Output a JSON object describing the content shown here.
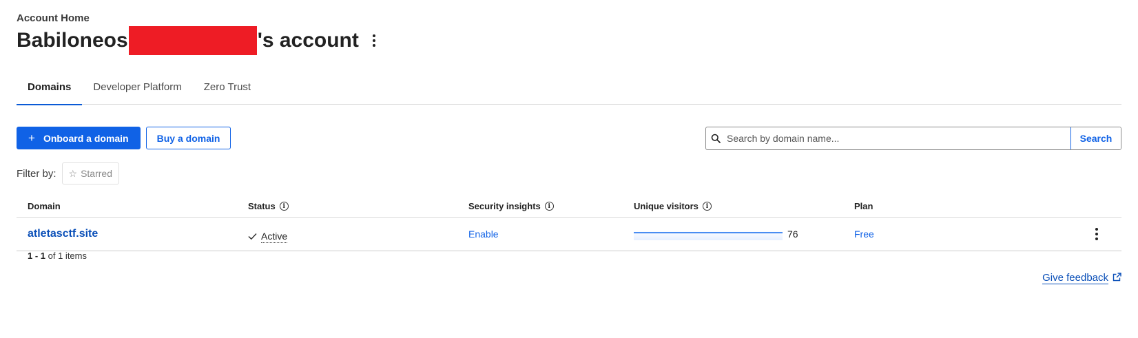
{
  "header": {
    "breadcrumb": "Account Home",
    "account_name_prefix": "Babiloneos",
    "account_name_suffix": "'s account",
    "redaction_color": "#ee1c25"
  },
  "tabs": [
    {
      "label": "Domains",
      "active": true
    },
    {
      "label": "Developer Platform",
      "active": false
    },
    {
      "label": "Zero Trust",
      "active": false
    }
  ],
  "actions": {
    "onboard_label": "Onboard a domain",
    "buy_label": "Buy a domain"
  },
  "search": {
    "placeholder": "Search by domain name...",
    "value": "",
    "button_label": "Search",
    "icon": "search-icon"
  },
  "filter": {
    "label": "Filter by:",
    "starred_label": "Starred",
    "icon": "star-outline-icon"
  },
  "table": {
    "columns": [
      "Domain",
      "Status",
      "Security insights",
      "Unique visitors",
      "Plan"
    ],
    "rows": [
      {
        "domain": "atletasctf.site",
        "status": "Active",
        "security_insights": "Enable",
        "unique_visitors": "76",
        "plan": "Free"
      }
    ]
  },
  "pagination": {
    "range": "1 - 1",
    "of_text": "of 1 items"
  },
  "feedback": {
    "label": "Give feedback",
    "icon": "external-link-icon"
  },
  "colors": {
    "accent": "#1062e6",
    "link": "#0a4fb8"
  }
}
